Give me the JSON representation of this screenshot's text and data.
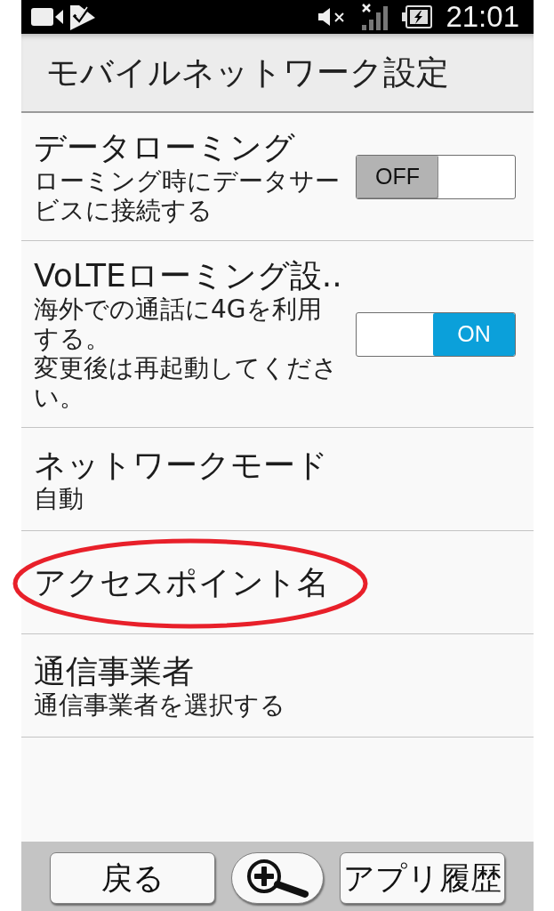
{
  "status_bar": {
    "time": "21:01"
  },
  "title": "モバイルネットワーク設定",
  "items": [
    {
      "kind": "toggle",
      "title": "データローミング",
      "subtitle": [
        "ローミング時にデータサービスに接続する"
      ],
      "toggle": {
        "on": false,
        "label": "OFF"
      },
      "highlighted": false
    },
    {
      "kind": "toggle",
      "title": "VoLTEローミング設..",
      "subtitle": [
        "海外での通話に4Gを利用する。",
        "変更後は再起動してください。"
      ],
      "toggle": {
        "on": true,
        "label": "ON"
      },
      "highlighted": false
    },
    {
      "kind": "plain",
      "title": "ネットワークモード",
      "subtitle": [
        "自動"
      ],
      "highlighted": false
    },
    {
      "kind": "plain",
      "title": "アクセスポイント名",
      "highlighted": true
    },
    {
      "kind": "plain",
      "title": "通信事業者",
      "subtitle": [
        "通信事業者を選択する"
      ],
      "highlighted": false
    }
  ],
  "nav_buttons": [
    {
      "kind": "text",
      "label": "戻る"
    },
    {
      "kind": "zoom"
    },
    {
      "kind": "text",
      "label": "アプリ履歴"
    }
  ]
}
